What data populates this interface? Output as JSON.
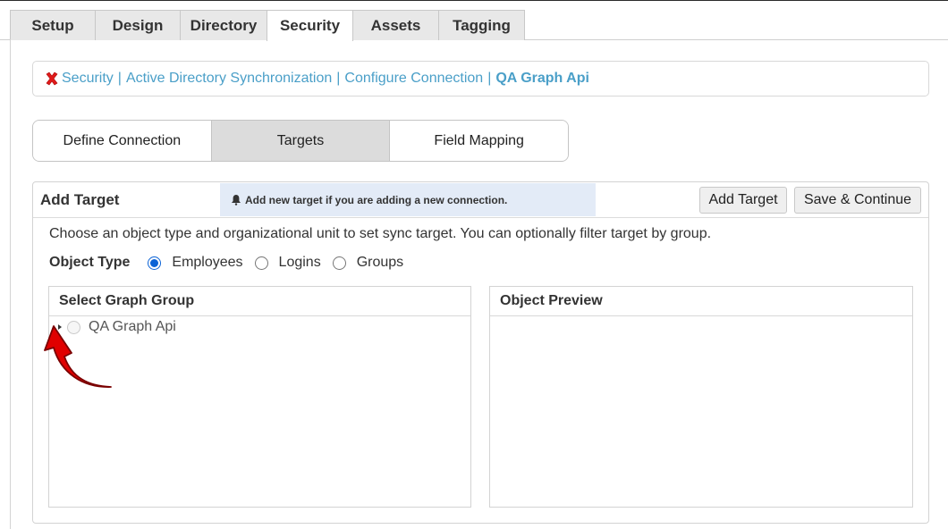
{
  "top_tabs": [
    {
      "label": "Setup"
    },
    {
      "label": "Design"
    },
    {
      "label": "Directory"
    },
    {
      "label": "Security",
      "active": true
    },
    {
      "label": "Assets"
    },
    {
      "label": "Tagging"
    }
  ],
  "breadcrumb": {
    "icon": "red-x-icon",
    "items": [
      "Security",
      "Active Directory Synchronization",
      "Configure Connection"
    ],
    "separator": "|",
    "current": "QA Graph Api"
  },
  "sub_tabs": [
    {
      "label": "Define Connection"
    },
    {
      "label": "Targets",
      "active": true
    },
    {
      "label": "Field Mapping"
    }
  ],
  "panel": {
    "title": "Add Target",
    "notice": "Add new target if you are adding a new connection.",
    "notice_icon": "bell-icon",
    "add_target_label": "Add Target",
    "save_continue_label": "Save & Continue",
    "instructions": "Choose an object type and organizational unit to set sync target. You can optionally filter target by group.",
    "object_type": {
      "label": "Object Type",
      "options": [
        "Employees",
        "Logins",
        "Groups"
      ],
      "selected": "Employees"
    },
    "select_group": {
      "title": "Select Graph Group",
      "tree": [
        {
          "label": "QA Graph Api"
        }
      ]
    },
    "object_preview": {
      "title": "Object Preview"
    }
  },
  "colors": {
    "link": "#4a9fc8",
    "notice_bg": "#e3ebf7",
    "active_subtab": "#dcdcdc",
    "radio_selected": "#0b63d6",
    "annotation_arrow": "#e00000"
  }
}
